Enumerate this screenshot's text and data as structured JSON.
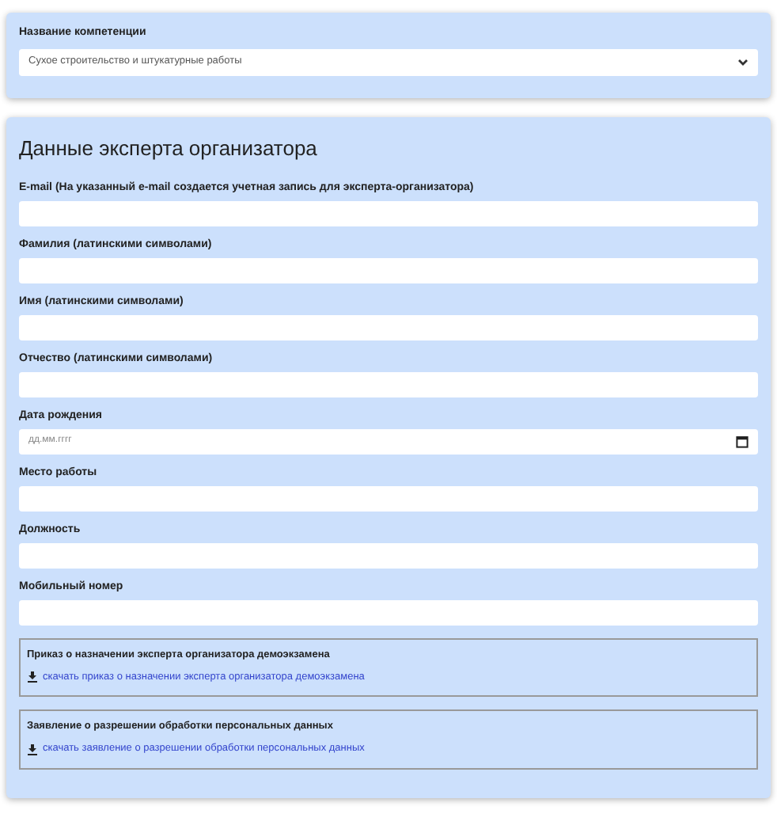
{
  "competence": {
    "label": "Название компетенции",
    "value": "Сухое строительство и штукатурные работы"
  },
  "expert": {
    "title": "Данные эксперта организатора",
    "fields": [
      {
        "label": "E-mail (На указанный e-mail создается учетная запись для эксперта-организатора)",
        "kind": "text"
      },
      {
        "label": "Фамилия (латинскими символами)",
        "kind": "text"
      },
      {
        "label": "Имя (латинскими символами)",
        "kind": "text"
      },
      {
        "label": "Отчество (латинскими символами)",
        "kind": "text"
      },
      {
        "label": "Дата рождения",
        "kind": "date",
        "placeholder": "дд.мм.гггг"
      },
      {
        "label": "Место работы",
        "kind": "text"
      },
      {
        "label": "Должность",
        "kind": "text"
      },
      {
        "label": "Мобильный номер",
        "kind": "text"
      }
    ],
    "documents": [
      {
        "title": "Приказ о назначении эксперта организатора демоэкзамена",
        "link": "скачать приказ о назначении эксперта организатора демоэкзамена"
      },
      {
        "title": "Заявление о разрешении обработки персональных данных",
        "link": "скачать заявление о разрешении обработки персональных данных"
      }
    ]
  }
}
